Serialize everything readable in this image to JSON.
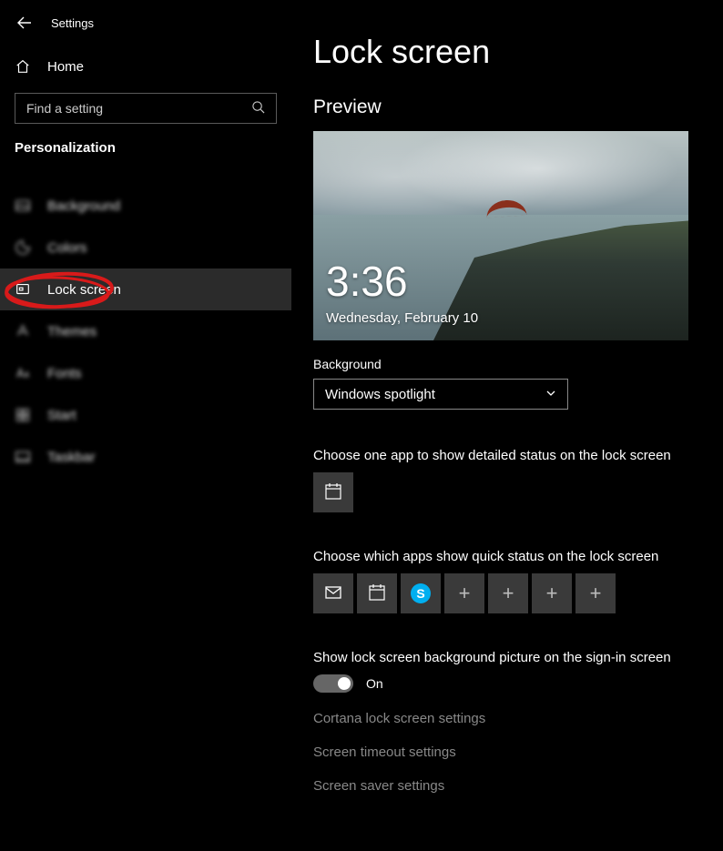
{
  "header": {
    "title": "Settings"
  },
  "home": {
    "label": "Home"
  },
  "search": {
    "placeholder": "Find a setting"
  },
  "section": {
    "heading": "Personalization"
  },
  "nav": {
    "items": [
      {
        "label": "Background"
      },
      {
        "label": "Colors"
      },
      {
        "label": "Lock screen"
      },
      {
        "label": "Themes"
      },
      {
        "label": "Fonts"
      },
      {
        "label": "Start"
      },
      {
        "label": "Taskbar"
      }
    ]
  },
  "main": {
    "title": "Lock screen",
    "preview_label": "Preview",
    "clock": "3:36",
    "date": "Wednesday, February 10",
    "background_label": "Background",
    "background_value": "Windows spotlight",
    "detailed_label": "Choose one app to show detailed status on the lock screen",
    "quick_label": "Choose which apps show quick status on the lock screen",
    "toggle_label": "Show lock screen background picture on the sign-in screen",
    "toggle_value": "On",
    "links": {
      "cortana": "Cortana lock screen settings",
      "timeout": "Screen timeout settings",
      "saver": "Screen saver settings"
    }
  },
  "quick_apps": [
    "mail",
    "calendar",
    "skype",
    "plus",
    "plus",
    "plus",
    "plus"
  ]
}
